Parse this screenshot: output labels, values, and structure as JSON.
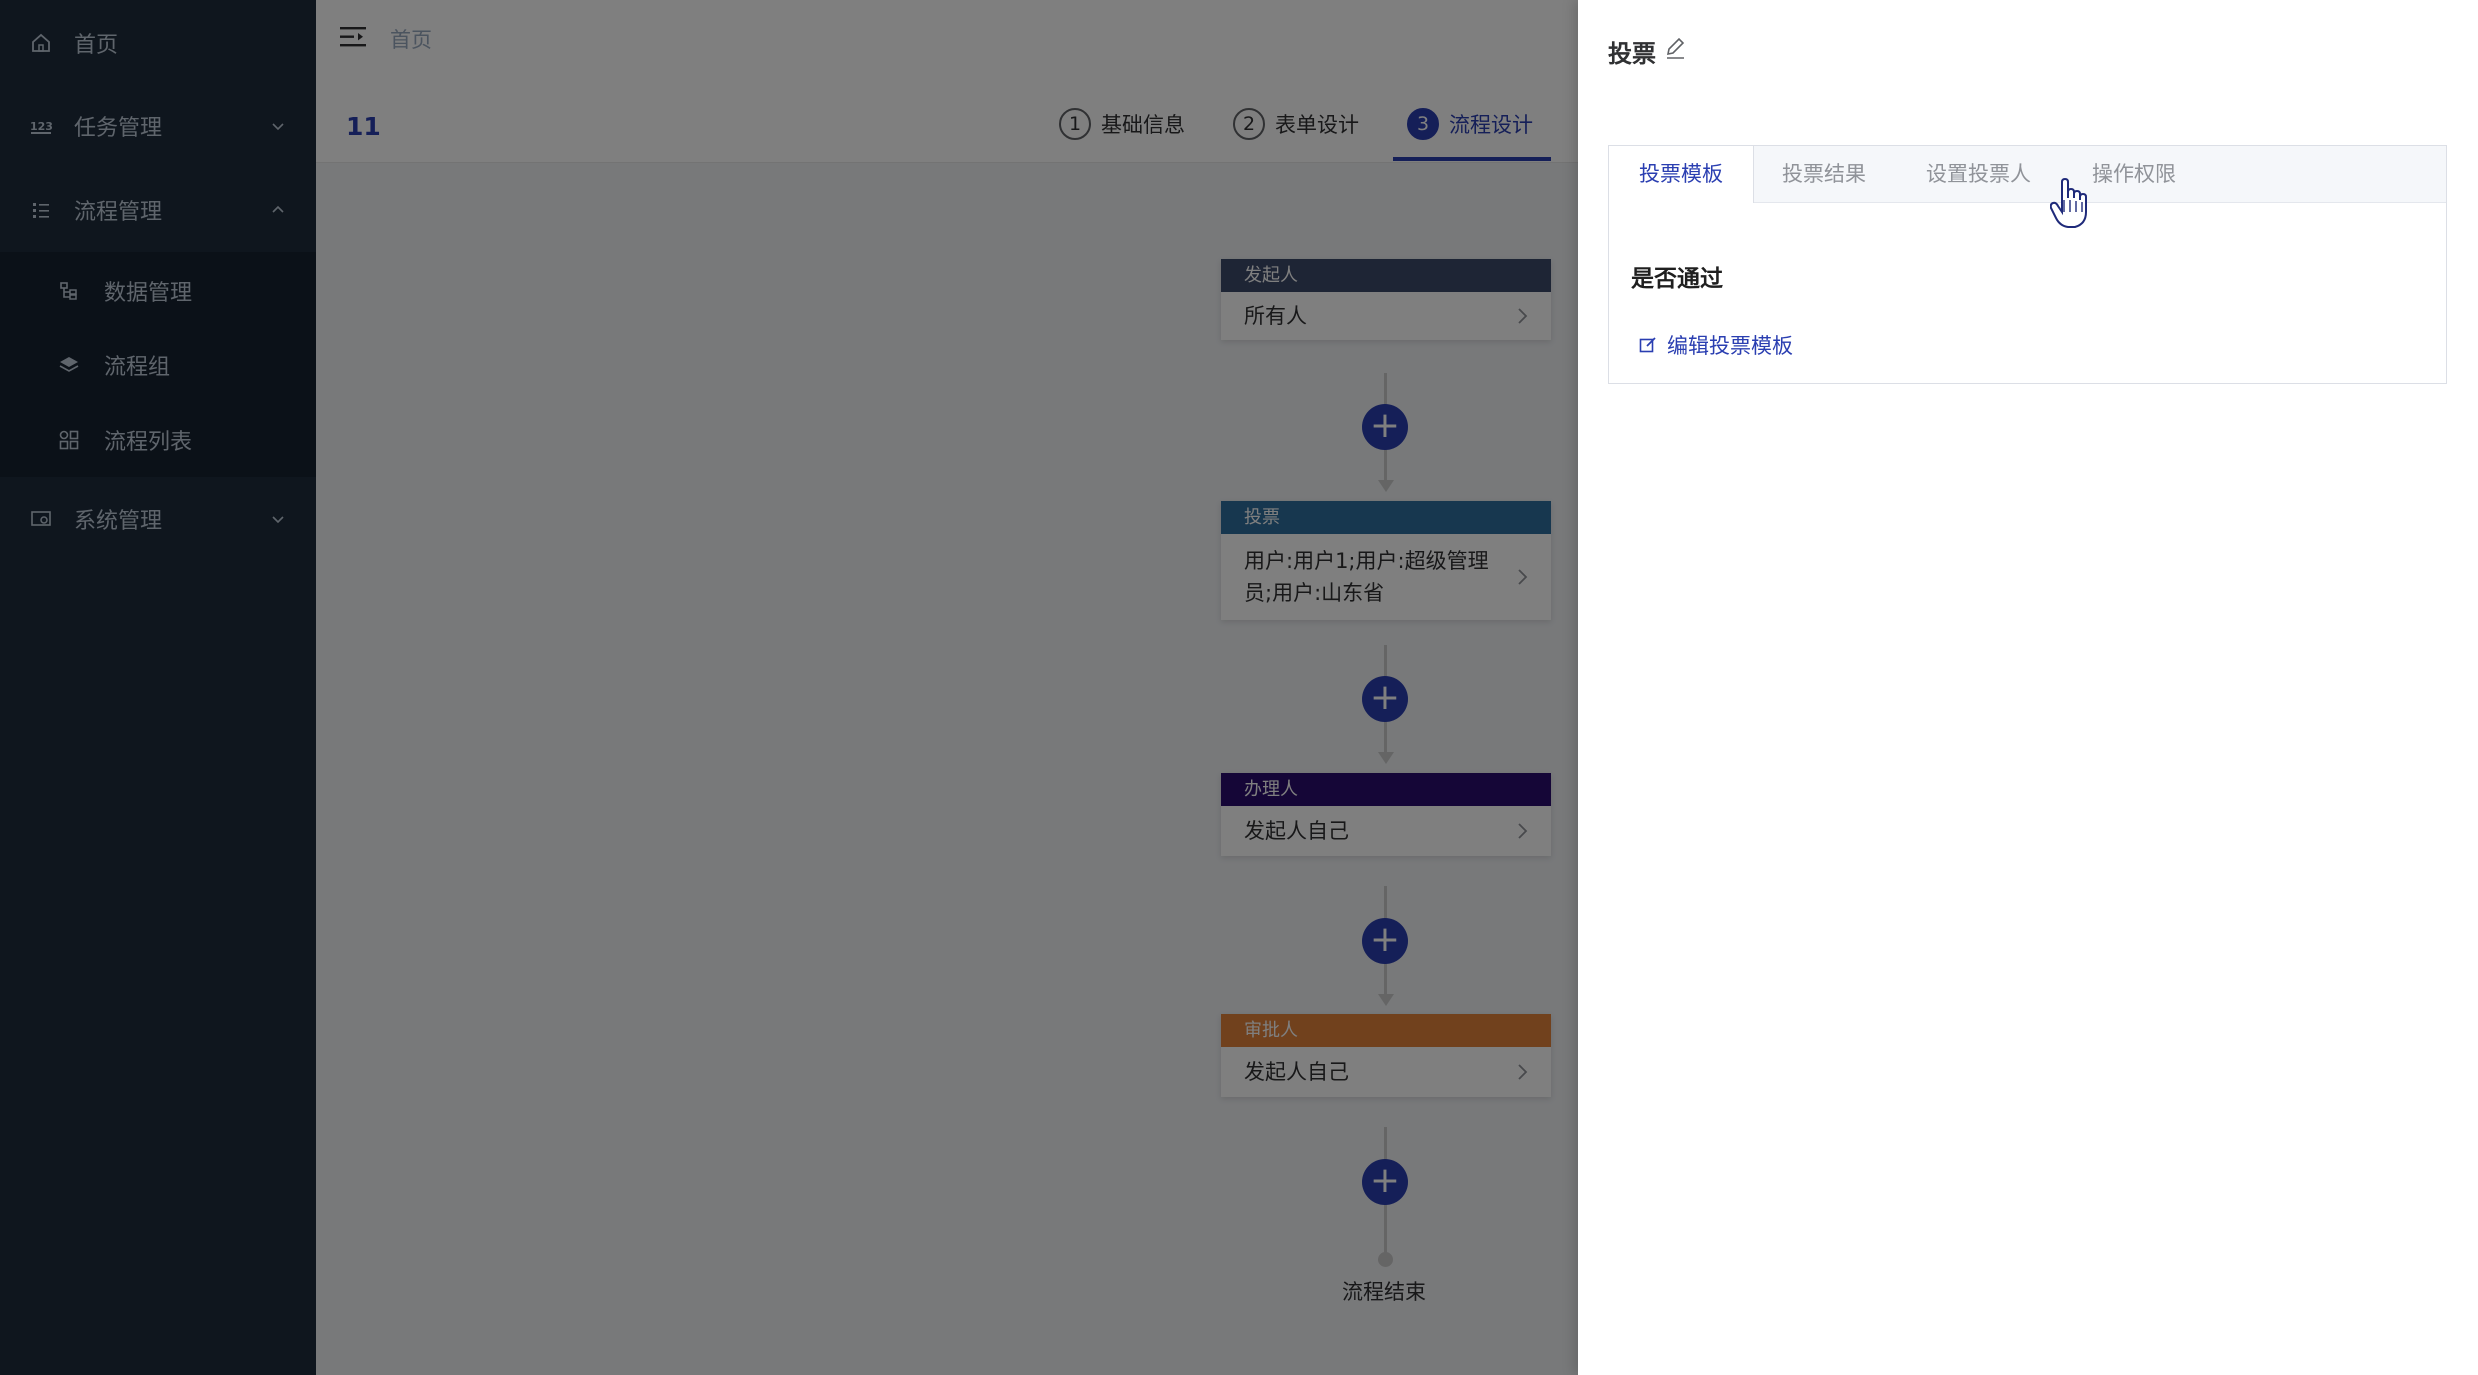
{
  "sidebar": {
    "items": [
      {
        "label": "首页",
        "icon": "home-icon"
      },
      {
        "label": "任务管理",
        "icon": "task-icon"
      },
      {
        "label": "流程管理",
        "icon": "process-icon"
      },
      {
        "label": "系统管理",
        "icon": "system-icon"
      }
    ],
    "submenu": [
      {
        "label": "数据管理",
        "icon": "data-icon"
      },
      {
        "label": "流程组",
        "icon": "layers-icon"
      },
      {
        "label": "流程列表",
        "icon": "grid-icon"
      }
    ]
  },
  "navbar": {
    "breadcrumb": "首页"
  },
  "header": {
    "process_name": "11",
    "steps": [
      {
        "num": "1",
        "label": "基础信息"
      },
      {
        "num": "2",
        "label": "表单设计"
      },
      {
        "num": "3",
        "label": "流程设计"
      }
    ]
  },
  "flow": {
    "nodes": [
      {
        "type": "发起人",
        "content": "所有人",
        "color": "#3d4a6b"
      },
      {
        "type": "投票",
        "content": "用户:用户1;用户:超级管理员;用户:山东省",
        "color": "#2e6f9e"
      },
      {
        "type": "办理人",
        "content": "发起人自己",
        "color": "#2b0d6e"
      },
      {
        "type": "审批人",
        "content": "发起人自己",
        "color": "#e2823b"
      }
    ],
    "add_symbol": "+",
    "end_label": "流程结束"
  },
  "drawer": {
    "title": "投票",
    "tabs": [
      "投票模板",
      "投票结果",
      "设置投票人",
      "操作权限"
    ],
    "content_title": "是否通过",
    "edit_link": "编辑投票模板"
  },
  "colors": {
    "accent": "#2a3eb1",
    "sidebar_bg": "#1f2d3d"
  }
}
